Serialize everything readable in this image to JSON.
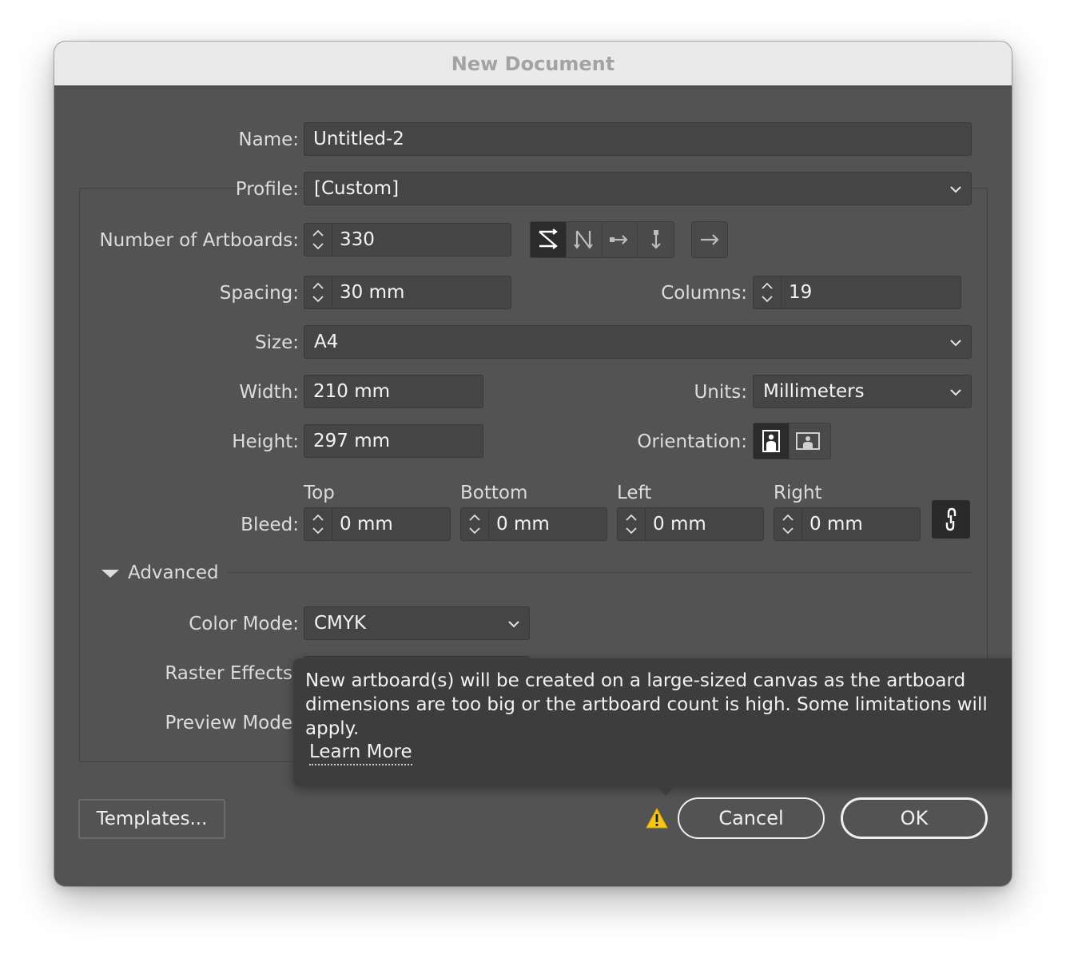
{
  "dialog": {
    "title": "New Document"
  },
  "form": {
    "name": {
      "label": "Name:",
      "value": "Untitled-2"
    },
    "profile": {
      "label": "Profile:",
      "value": "[Custom]"
    },
    "artboards": {
      "label": "Number of Artboards:",
      "value": "330"
    },
    "artboard_layout_icons": [
      "grid-by-row-icon",
      "grid-by-column-icon",
      "arrange-by-row-icon",
      "arrange-by-column-icon",
      "right-to-left-layout-icon"
    ],
    "spacing": {
      "label": "Spacing:",
      "value": "30 mm"
    },
    "columns": {
      "label": "Columns:",
      "value": "19"
    },
    "size": {
      "label": "Size:",
      "value": "A4"
    },
    "width": {
      "label": "Width:",
      "value": "210 mm"
    },
    "units": {
      "label": "Units:",
      "value": "Millimeters"
    },
    "height": {
      "label": "Height:",
      "value": "297 mm"
    },
    "orientation": {
      "label": "Orientation:",
      "selected": "portrait"
    },
    "bleed": {
      "label": "Bleed:",
      "top": {
        "header": "Top",
        "value": "0 mm"
      },
      "bottom": {
        "header": "Bottom",
        "value": "0 mm"
      },
      "left": {
        "header": "Left",
        "value": "0 mm"
      },
      "right": {
        "header": "Right",
        "value": "0 mm"
      }
    },
    "advanced": {
      "label": "Advanced",
      "color_mode": {
        "label": "Color Mode:",
        "value": "CMYK"
      },
      "raster_effects": {
        "label": "Raster Effects"
      },
      "preview_mode": {
        "label": "Preview Mode"
      }
    }
  },
  "tooltip": {
    "message": "New artboard(s) will be created on a large-sized canvas as the artboard dimensions are too big or the artboard count is high. Some limitations will apply.",
    "link": "Learn More"
  },
  "buttons": {
    "templates": "Templates...",
    "cancel": "Cancel",
    "ok": "OK"
  },
  "colors": {
    "dialog_bg": "#535353",
    "field_bg": "#454545",
    "tooltip_bg": "#3d3d3d",
    "warning": "#f5c518"
  }
}
